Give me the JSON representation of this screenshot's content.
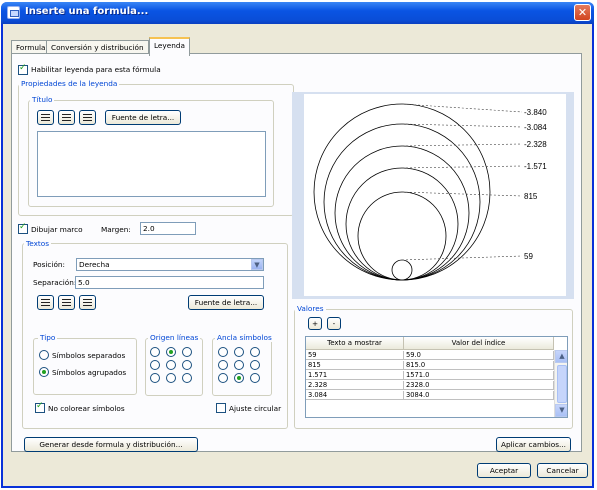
{
  "window": {
    "title": "Inserte una formula...",
    "close": "✕"
  },
  "tabs": [
    "Formula",
    "Conversión y distribución",
    "Leyenda"
  ],
  "legend": {
    "enable_label": "Habilitar leyenda para esta fórmula",
    "props_title": "Propiedades de la leyenda",
    "titulo_title": "Título",
    "font_button": "Fuente de letra...",
    "draw_frame_label": "Dibujar marco",
    "margin_label": "Margen:",
    "margin_value": "2.0",
    "textos_title": "Textos",
    "position_label": "Posición:",
    "position_value": "Derecha",
    "separation_label": "Separación:",
    "separation_value": "5.0",
    "font_button2": "Fuente de letra...",
    "tipo_title": "Tipo",
    "tipo_opt1": "Símbolos separados",
    "tipo_opt2": "Símbolos agrupados",
    "origen_title": "Origen líneas",
    "ancla_title": "Ancla símbolos",
    "no_color_label": "No colorear símbolos",
    "ajuste_label": "Ajuste circular",
    "valores_title": "Valores",
    "add": "+",
    "remove": "-",
    "table_headers": [
      "Texto a mostrar",
      "Valor del índice"
    ],
    "rows": [
      [
        "59",
        "59.0"
      ],
      [
        "815",
        "815.0"
      ],
      [
        "1.571",
        "1571.0"
      ],
      [
        "2.328",
        "2328.0"
      ],
      [
        "3.084",
        "3084.0"
      ]
    ],
    "preview_labels": [
      "-3.840",
      "-3.084",
      "-2.328",
      "-1.571",
      "815",
      "59"
    ],
    "generate_button": "Generar desde formula y distribución...",
    "apply_button": "Aplicar cambios...",
    "accept_button": "Aceptar",
    "cancel_button": "Cancelar"
  }
}
